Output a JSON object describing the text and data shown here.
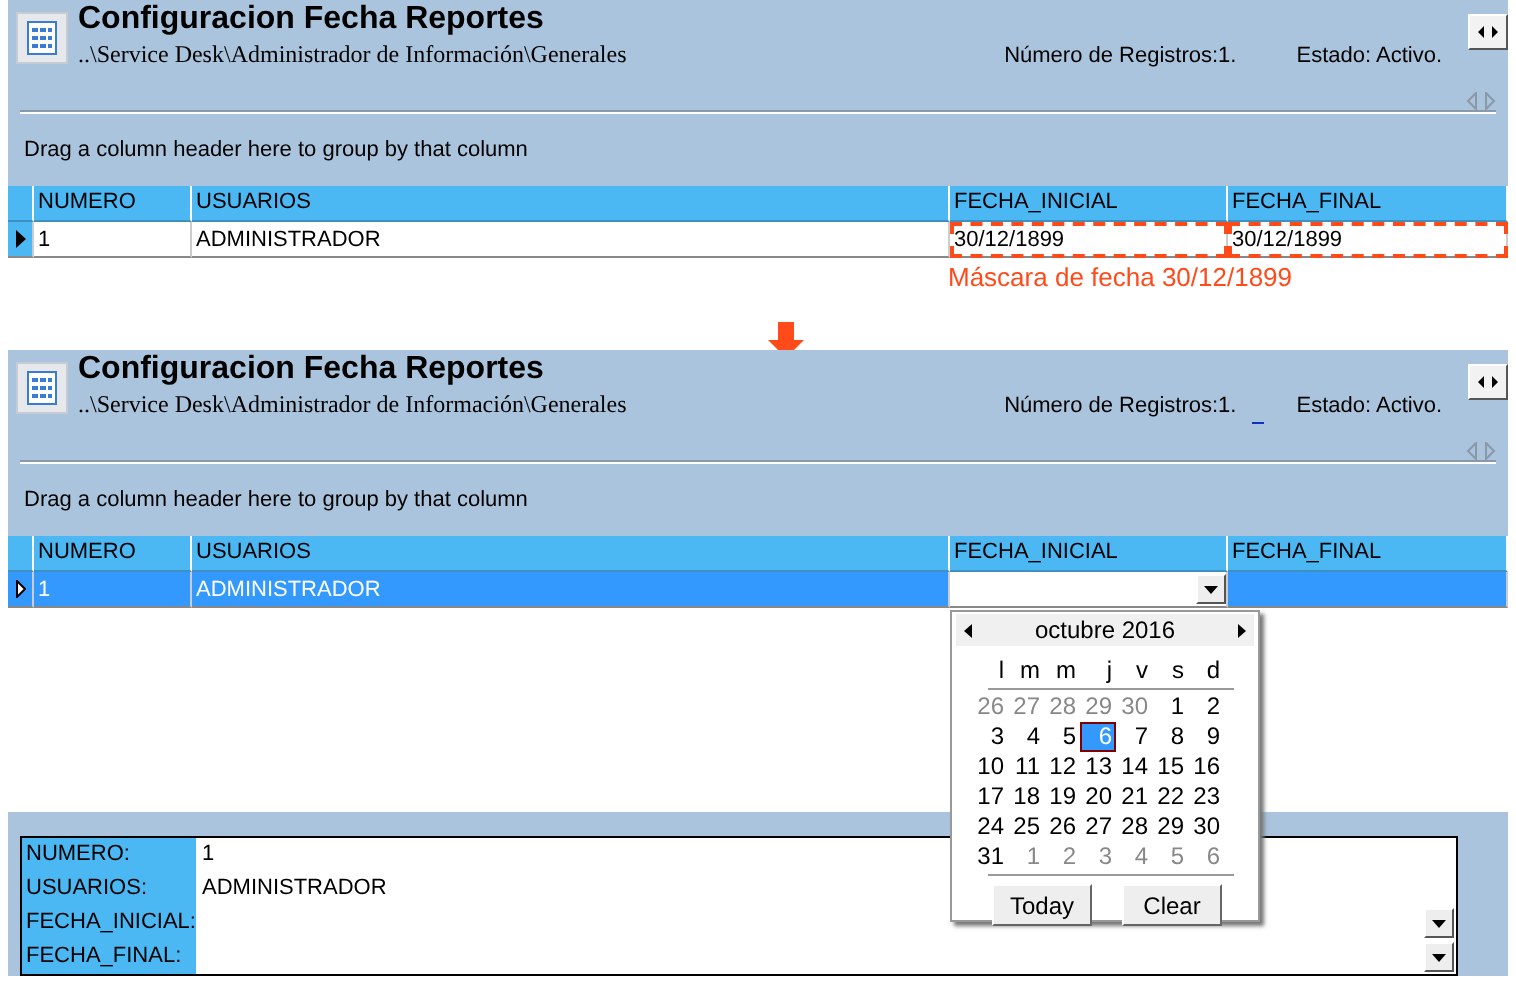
{
  "screens": [
    {
      "title": "Configuracion Fecha Reportes",
      "path": "..\\Service Desk\\Administrador de Información\\Generales",
      "record_count": "Número de Registros:1.",
      "status": "Estado: Activo.",
      "group_hint": "Drag a column header here to group by that column",
      "columns": [
        "NUMERO",
        "USUARIOS",
        "FECHA_INICIAL",
        "FECHA_FINAL"
      ],
      "rows": [
        {
          "selected": false,
          "cells": [
            {
              "kind": "text",
              "text": "1",
              "marked": false
            },
            {
              "kind": "text",
              "text": "ADMINISTRADOR",
              "marked": false
            },
            {
              "kind": "text",
              "text": "30/12/1899",
              "marked": true
            },
            {
              "kind": "text",
              "text": "30/12/1899",
              "marked": true
            }
          ]
        }
      ],
      "annotation": "Máscara de fecha 30/12/1899"
    },
    {
      "title": "Configuracion Fecha Reportes",
      "path": "..\\Service Desk\\Administrador de Información\\Generales",
      "record_count": "Número de Registros:1.",
      "status": "Estado: Activo.",
      "cursor_visible": true,
      "group_hint": "Drag a column header here to group by that column",
      "columns": [
        "NUMERO",
        "USUARIOS",
        "FECHA_INICIAL",
        "FECHA_FINAL"
      ],
      "rows": [
        {
          "selected": true,
          "cells": [
            {
              "kind": "text",
              "text": "1"
            },
            {
              "kind": "text",
              "text": "ADMINISTRADOR"
            },
            {
              "kind": "dropdown"
            },
            {
              "kind": "text"
            }
          ]
        }
      ],
      "calendar": {
        "month": "octubre 2016",
        "weekdays": [
          "l",
          "m",
          "m",
          "j",
          "v",
          "s",
          "d"
        ],
        "weeks": [
          [
            {
              "day": "26",
              "in_month": false,
              "selected": false
            },
            {
              "day": "27",
              "in_month": false,
              "selected": false
            },
            {
              "day": "28",
              "in_month": false,
              "selected": false
            },
            {
              "day": "29",
              "in_month": false,
              "selected": false
            },
            {
              "day": "30",
              "in_month": false,
              "selected": false
            },
            {
              "day": "1",
              "in_month": true,
              "selected": false
            },
            {
              "day": "2",
              "in_month": true,
              "selected": false
            }
          ],
          [
            {
              "day": "3",
              "in_month": true,
              "selected": false
            },
            {
              "day": "4",
              "in_month": true,
              "selected": false
            },
            {
              "day": "5",
              "in_month": true,
              "selected": false
            },
            {
              "day": "6",
              "in_month": true,
              "selected": true
            },
            {
              "day": "7",
              "in_month": true,
              "selected": false
            },
            {
              "day": "8",
              "in_month": true,
              "selected": false
            },
            {
              "day": "9",
              "in_month": true,
              "selected": false
            }
          ],
          [
            {
              "day": "10",
              "in_month": true,
              "selected": false
            },
            {
              "day": "11",
              "in_month": true,
              "selected": false
            },
            {
              "day": "12",
              "in_month": true,
              "selected": false
            },
            {
              "day": "13",
              "in_month": true,
              "selected": false
            },
            {
              "day": "14",
              "in_month": true,
              "selected": false
            },
            {
              "day": "15",
              "in_month": true,
              "selected": false
            },
            {
              "day": "16",
              "in_month": true,
              "selected": false
            }
          ],
          [
            {
              "day": "17",
              "in_month": true,
              "selected": false
            },
            {
              "day": "18",
              "in_month": true,
              "selected": false
            },
            {
              "day": "19",
              "in_month": true,
              "selected": false
            },
            {
              "day": "20",
              "in_month": true,
              "selected": false
            },
            {
              "day": "21",
              "in_month": true,
              "selected": false
            },
            {
              "day": "22",
              "in_month": true,
              "selected": false
            },
            {
              "day": "23",
              "in_month": true,
              "selected": false
            }
          ],
          [
            {
              "day": "24",
              "in_month": true,
              "selected": false
            },
            {
              "day": "25",
              "in_month": true,
              "selected": false
            },
            {
              "day": "26",
              "in_month": true,
              "selected": false
            },
            {
              "day": "27",
              "in_month": true,
              "selected": false
            },
            {
              "day": "28",
              "in_month": true,
              "selected": false
            },
            {
              "day": "29",
              "in_month": true,
              "selected": false
            },
            {
              "day": "30",
              "in_month": true,
              "selected": false
            }
          ],
          [
            {
              "day": "31",
              "in_month": true,
              "selected": false
            },
            {
              "day": "1",
              "in_month": false,
              "selected": false
            },
            {
              "day": "2",
              "in_month": false,
              "selected": false
            },
            {
              "day": "3",
              "in_month": false,
              "selected": false
            },
            {
              "day": "4",
              "in_month": false,
              "selected": false
            },
            {
              "day": "5",
              "in_month": false,
              "selected": false
            },
            {
              "day": "6",
              "in_month": false,
              "selected": false
            }
          ]
        ],
        "buttons": [
          "Today",
          "Clear"
        ]
      },
      "detail": [
        {
          "label": "NUMERO:",
          "value": "1",
          "kind": "text"
        },
        {
          "label": "USUARIOS:",
          "value": "ADMINISTRADOR",
          "kind": "text"
        },
        {
          "label": "FECHA_INICIAL:",
          "kind": "dropdown"
        },
        {
          "label": "FECHA_FINAL:",
          "kind": "dropdown"
        }
      ]
    }
  ]
}
